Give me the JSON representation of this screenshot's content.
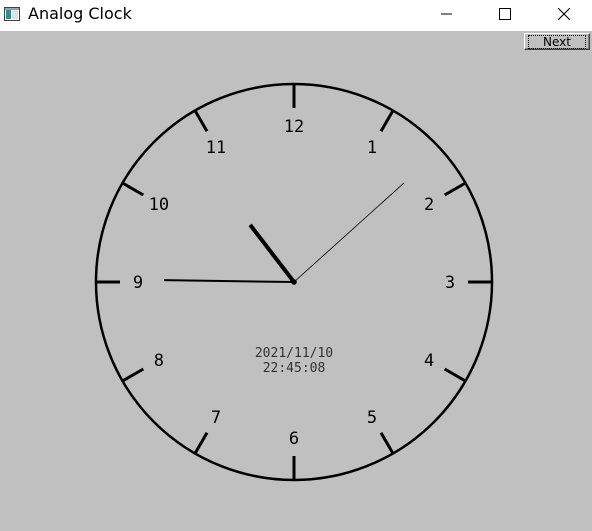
{
  "window": {
    "title": "Analog Clock",
    "icon": "app-window-icon",
    "controls": [
      "minimize-icon",
      "maximize-icon",
      "close-icon"
    ]
  },
  "toolbar": {
    "next_label": "Next"
  },
  "clock": {
    "numerals": [
      "12",
      "1",
      "2",
      "3",
      "4",
      "5",
      "6",
      "7",
      "8",
      "9",
      "10",
      "11"
    ],
    "date": "2021/11/10",
    "time": "22:45:08",
    "hours": 22,
    "minutes": 45,
    "seconds": 8
  },
  "colors": {
    "background": "#c0c0c0",
    "face_stroke": "#000000",
    "text": "#000000"
  }
}
